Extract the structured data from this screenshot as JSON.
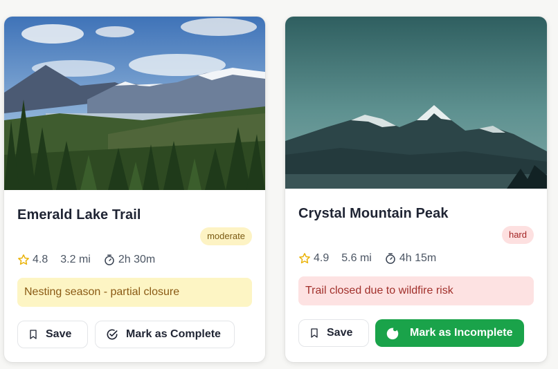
{
  "cards": [
    {
      "title": "Emerald Lake Trail",
      "difficulty": "moderate",
      "rating": "4.8",
      "distance": "3.2 mi",
      "duration": "2h 30m",
      "alert": "Nesting season - partial closure",
      "save_label": "Save",
      "action_label": "Mark as Complete"
    },
    {
      "title": "Crystal Mountain Peak",
      "difficulty": "hard",
      "rating": "4.9",
      "distance": "5.6 mi",
      "duration": "4h 15m",
      "alert": "Trail closed due to wildfire risk",
      "save_label": "Save",
      "action_label": "Mark as Incomplete"
    }
  ],
  "colors": {
    "moderate_badge_bg": "#fdf3c4",
    "hard_badge_bg": "#fde0e0",
    "warning_alert_bg": "#fdf5c4",
    "danger_alert_bg": "#fde2e2",
    "complete_button_green": "#1aa34a",
    "star_yellow": "#eab308"
  },
  "icons": {
    "rating": "star-icon",
    "duration": "stopwatch-icon",
    "save": "bookmark-icon",
    "complete": "check-circle-icon",
    "incomplete": "filled-circle-icon"
  }
}
